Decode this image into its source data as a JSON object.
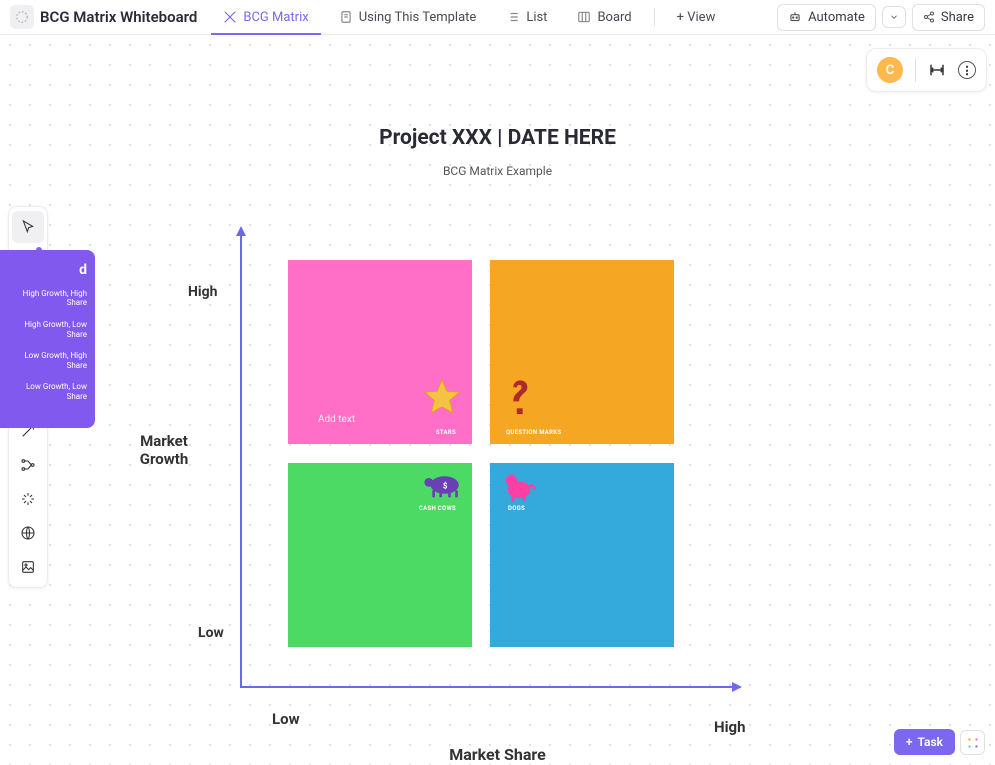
{
  "header": {
    "doc_title": "BCG Matrix Whiteboard",
    "tabs": [
      "BCG Matrix",
      "Using This Template",
      "List",
      "Board"
    ],
    "view_label": "+ View",
    "automate_label": "Automate",
    "share_label": "Share"
  },
  "presence": {
    "avatar_initial": "C"
  },
  "legend": {
    "header": "d",
    "items": [
      "High Growth, High\nShare",
      "High Growth, Low\nShare",
      "Low Growth, High\nShare",
      "Low Growth, Low\nShare"
    ]
  },
  "chart_data": {
    "type": "table",
    "title": "Project XXX | DATE HERE",
    "subtitle": "BCG Matrix Example",
    "xlabel": "Market Share",
    "ylabel": "Market Growth",
    "x_axis": {
      "low": "Low",
      "high": "High"
    },
    "y_axis": {
      "low": "Low",
      "high": "High"
    },
    "quadrants": [
      {
        "name": "STARS",
        "color": "#ff6ec7",
        "icon": "star",
        "growth": "High",
        "share": "High",
        "placeholder": "Add text"
      },
      {
        "name": "QUESTION MARKS",
        "color": "#f5a623",
        "icon": "question",
        "growth": "High",
        "share": "Low"
      },
      {
        "name": "CASH COWS",
        "color": "#4cd964",
        "icon": "cow",
        "growth": "Low",
        "share": "High"
      },
      {
        "name": "DOGS",
        "color": "#34aadc",
        "icon": "dog",
        "growth": "Low",
        "share": "Low"
      }
    ]
  },
  "bottom": {
    "task_label": "Task"
  }
}
